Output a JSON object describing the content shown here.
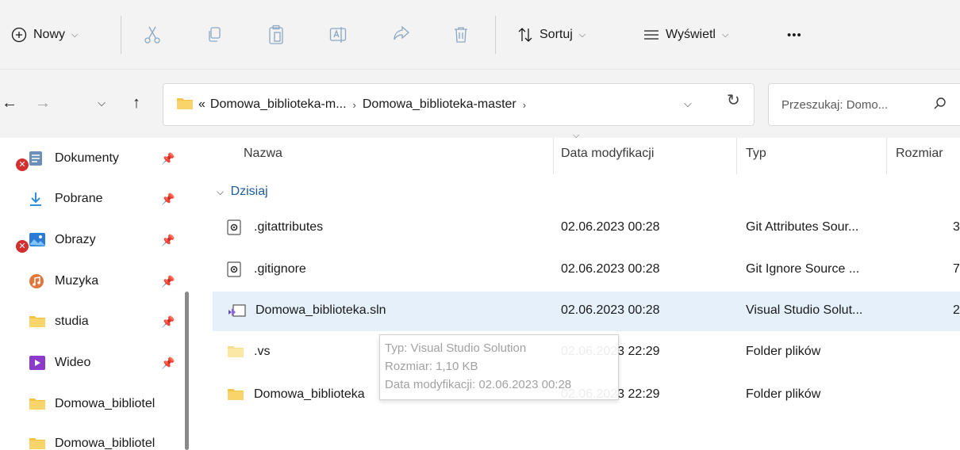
{
  "toolbar": {
    "new_label": "Nowy",
    "sort_label": "Sortuj",
    "view_label": "Wyświetl",
    "more_label": "•••"
  },
  "address": {
    "overflow": "«",
    "crumbs": [
      "Domowa_biblioteka-m...",
      "Domowa_biblioteka-master"
    ],
    "search_placeholder": "Przeszukaj: Domo..."
  },
  "sidebar": {
    "items": [
      {
        "label": "Dokumenty",
        "icon": "documents-icon",
        "pinned": true,
        "error": true
      },
      {
        "label": "Pobrane",
        "icon": "download-icon",
        "pinned": true,
        "error": false
      },
      {
        "label": "Obrazy",
        "icon": "pictures-icon",
        "pinned": true,
        "error": true
      },
      {
        "label": "Muzyka",
        "icon": "music-icon",
        "pinned": true,
        "error": false
      },
      {
        "label": "studia",
        "icon": "folder-icon",
        "pinned": true,
        "error": false
      },
      {
        "label": "Wideo",
        "icon": "video-icon",
        "pinned": true,
        "error": false
      },
      {
        "label": "Domowa_bibliotel",
        "icon": "folder-icon",
        "pinned": false,
        "error": false
      },
      {
        "label": "Domowa_bibliotel",
        "icon": "folder-icon",
        "pinned": false,
        "error": false
      }
    ]
  },
  "columns": {
    "name": "Nazwa",
    "date": "Data modyfikacji",
    "type": "Typ",
    "size": "Rozmiar"
  },
  "group_label": "Dzisiaj",
  "files": [
    {
      "name": ".gitattributes",
      "date": "02.06.2023 00:28",
      "type": "Git Attributes Sour...",
      "size": "3",
      "icon": "config-file-icon"
    },
    {
      "name": ".gitignore",
      "date": "02.06.2023 00:28",
      "type": "Git Ignore Source ...",
      "size": "7",
      "icon": "config-file-icon"
    },
    {
      "name": "Domowa_biblioteka.sln",
      "date": "02.06.2023 00:28",
      "type": "Visual Studio Solut...",
      "size": "2",
      "icon": "visual-studio-solution-icon"
    },
    {
      "name": ".vs",
      "date": "02.06.2023 22:29",
      "type": "Folder plików",
      "size": "",
      "icon": "folder-icon"
    },
    {
      "name": "Domowa_biblioteka",
      "date": "02.06.2023 22:29",
      "type": "Folder plików",
      "size": "",
      "icon": "folder-icon"
    }
  ],
  "tooltip": {
    "type_line": "Typ: Visual Studio Solution",
    "size_line": "Rozmiar: 1,10 KB",
    "date_line": "Data modyfikacji: 02.06.2023 00:28"
  },
  "colors": {
    "toolbar_bg": "#f3f3f3",
    "selected_row": "#e5f0fb",
    "folder": "#f4c542",
    "link_blue": "#1e5a9f",
    "error_red": "#d32f2f"
  }
}
